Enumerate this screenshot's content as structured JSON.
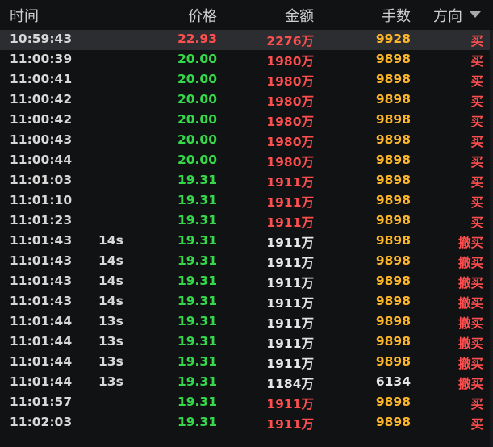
{
  "header": {
    "time": "时间",
    "price": "价格",
    "amount": "金额",
    "qty": "手数",
    "direction": "方向",
    "sort_icon": "triangle-down-icon"
  },
  "colors": {
    "up": "#ff4e4e",
    "down": "#35d84a",
    "neutral": "#e6e6e6",
    "qty": "#ffb72a",
    "selected_row": "#2c2d31",
    "background": "#111214"
  },
  "rows": [
    {
      "time": "10:59:43",
      "delay": "",
      "price": "22.93",
      "price_color": "red",
      "amount": "2276万",
      "amount_color": "red",
      "qty": "9928",
      "qty_color": "yellow",
      "dir": "买",
      "selected": true
    },
    {
      "time": "11:00:39",
      "delay": "",
      "price": "20.00",
      "price_color": "green",
      "amount": "1980万",
      "amount_color": "red",
      "qty": "9898",
      "qty_color": "yellow",
      "dir": "买"
    },
    {
      "time": "11:00:41",
      "delay": "",
      "price": "20.00",
      "price_color": "green",
      "amount": "1980万",
      "amount_color": "red",
      "qty": "9898",
      "qty_color": "yellow",
      "dir": "买"
    },
    {
      "time": "11:00:42",
      "delay": "",
      "price": "20.00",
      "price_color": "green",
      "amount": "1980万",
      "amount_color": "red",
      "qty": "9898",
      "qty_color": "yellow",
      "dir": "买"
    },
    {
      "time": "11:00:42",
      "delay": "",
      "price": "20.00",
      "price_color": "green",
      "amount": "1980万",
      "amount_color": "red",
      "qty": "9898",
      "qty_color": "yellow",
      "dir": "买"
    },
    {
      "time": "11:00:43",
      "delay": "",
      "price": "20.00",
      "price_color": "green",
      "amount": "1980万",
      "amount_color": "red",
      "qty": "9898",
      "qty_color": "yellow",
      "dir": "买"
    },
    {
      "time": "11:00:44",
      "delay": "",
      "price": "20.00",
      "price_color": "green",
      "amount": "1980万",
      "amount_color": "red",
      "qty": "9898",
      "qty_color": "yellow",
      "dir": "买"
    },
    {
      "time": "11:01:03",
      "delay": "",
      "price": "19.31",
      "price_color": "green",
      "amount": "1911万",
      "amount_color": "red",
      "qty": "9898",
      "qty_color": "yellow",
      "dir": "买"
    },
    {
      "time": "11:01:10",
      "delay": "",
      "price": "19.31",
      "price_color": "green",
      "amount": "1911万",
      "amount_color": "red",
      "qty": "9898",
      "qty_color": "yellow",
      "dir": "买"
    },
    {
      "time": "11:01:23",
      "delay": "",
      "price": "19.31",
      "price_color": "green",
      "amount": "1911万",
      "amount_color": "red",
      "qty": "9898",
      "qty_color": "yellow",
      "dir": "买"
    },
    {
      "time": "11:01:43",
      "delay": "14s",
      "price": "19.31",
      "price_color": "green",
      "amount": "1911万",
      "amount_color": "white",
      "qty": "9898",
      "qty_color": "yellow",
      "dir": "撤买"
    },
    {
      "time": "11:01:43",
      "delay": "14s",
      "price": "19.31",
      "price_color": "green",
      "amount": "1911万",
      "amount_color": "white",
      "qty": "9898",
      "qty_color": "yellow",
      "dir": "撤买"
    },
    {
      "time": "11:01:43",
      "delay": "14s",
      "price": "19.31",
      "price_color": "green",
      "amount": "1911万",
      "amount_color": "white",
      "qty": "9898",
      "qty_color": "yellow",
      "dir": "撤买"
    },
    {
      "time": "11:01:43",
      "delay": "14s",
      "price": "19.31",
      "price_color": "green",
      "amount": "1911万",
      "amount_color": "white",
      "qty": "9898",
      "qty_color": "yellow",
      "dir": "撤买"
    },
    {
      "time": "11:01:44",
      "delay": "13s",
      "price": "19.31",
      "price_color": "green",
      "amount": "1911万",
      "amount_color": "white",
      "qty": "9898",
      "qty_color": "yellow",
      "dir": "撤买"
    },
    {
      "time": "11:01:44",
      "delay": "13s",
      "price": "19.31",
      "price_color": "green",
      "amount": "1911万",
      "amount_color": "white",
      "qty": "9898",
      "qty_color": "yellow",
      "dir": "撤买"
    },
    {
      "time": "11:01:44",
      "delay": "13s",
      "price": "19.31",
      "price_color": "green",
      "amount": "1911万",
      "amount_color": "white",
      "qty": "9898",
      "qty_color": "yellow",
      "dir": "撤买"
    },
    {
      "time": "11:01:44",
      "delay": "13s",
      "price": "19.31",
      "price_color": "green",
      "amount": "1184万",
      "amount_color": "white",
      "qty": "6134",
      "qty_color": "white",
      "dir": "撤买"
    },
    {
      "time": "11:01:57",
      "delay": "",
      "price": "19.31",
      "price_color": "green",
      "amount": "1911万",
      "amount_color": "red",
      "qty": "9898",
      "qty_color": "yellow",
      "dir": "买"
    },
    {
      "time": "11:02:03",
      "delay": "",
      "price": "19.31",
      "price_color": "green",
      "amount": "1911万",
      "amount_color": "red",
      "qty": "9898",
      "qty_color": "yellow",
      "dir": "买"
    }
  ]
}
